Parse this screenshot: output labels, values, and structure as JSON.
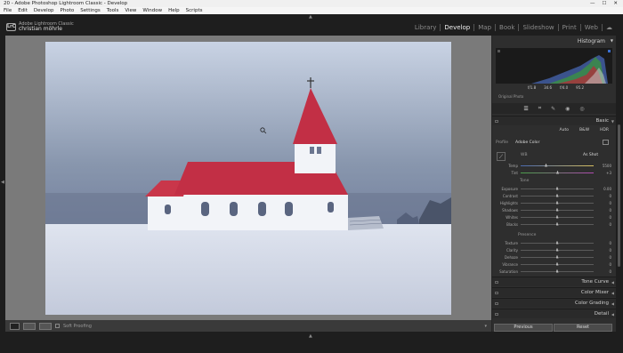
{
  "window": {
    "title": "20 - Adobe Photoshop Lightroom Classic - Develop",
    "minimize": "—",
    "maximize": "☐",
    "close": "✕"
  },
  "menu": [
    "File",
    "Edit",
    "Develop",
    "Photo",
    "Settings",
    "Tools",
    "View",
    "Window",
    "Help",
    "Scripts"
  ],
  "identity": {
    "logo": "LrC",
    "product": "Adobe Lightroom Classic",
    "user": "christian möhrle"
  },
  "modules": [
    {
      "label": "Library",
      "active": false
    },
    {
      "label": "Develop",
      "active": true
    },
    {
      "label": "Map",
      "active": false
    },
    {
      "label": "Book",
      "active": false
    },
    {
      "label": "Slideshow",
      "active": false
    },
    {
      "label": "Print",
      "active": false
    },
    {
      "label": "Web",
      "active": false
    }
  ],
  "toolbar": {
    "soft_proofing": "Soft Proofing"
  },
  "histogram": {
    "title": "Histogram",
    "readout": [
      "f/1.8",
      "34.6",
      "f/4.0",
      "95.2"
    ],
    "original_photo": "Original Photo"
  },
  "basic": {
    "title": "Basic",
    "auto": "Auto",
    "bw": "B&W",
    "hdr": "HDR",
    "profile_label": "Profile",
    "profile_value": "Adobe Color",
    "wb_label": "WB",
    "wb_value": "As Shot",
    "temp_label": "Temp",
    "temp_value": "5500",
    "tint_label": "Tint",
    "tint_value": "+3",
    "tone_label": "Tone",
    "presence_label": "Presence",
    "sliders_tone": [
      {
        "label": "Exposure",
        "value": "0.00",
        "pos": 0.5
      },
      {
        "label": "Contrast",
        "value": "0",
        "pos": 0.5
      },
      {
        "label": "Highlights",
        "value": "0",
        "pos": 0.5
      },
      {
        "label": "Shadows",
        "value": "0",
        "pos": 0.5
      },
      {
        "label": "Whites",
        "value": "0",
        "pos": 0.5
      },
      {
        "label": "Blacks",
        "value": "0",
        "pos": 0.5
      }
    ],
    "sliders_presence": [
      {
        "label": "Texture",
        "value": "0",
        "pos": 0.5
      },
      {
        "label": "Clarity",
        "value": "0",
        "pos": 0.5
      },
      {
        "label": "Dehaze",
        "value": "0",
        "pos": 0.5
      },
      {
        "label": "Vibrance",
        "value": "0",
        "pos": 0.5
      },
      {
        "label": "Saturation",
        "value": "0",
        "pos": 0.5
      }
    ]
  },
  "sections": [
    "Tone Curve",
    "Color Mixer",
    "Color Grading",
    "Detail"
  ],
  "buttons": {
    "previous": "Previous",
    "reset": "Reset"
  }
}
